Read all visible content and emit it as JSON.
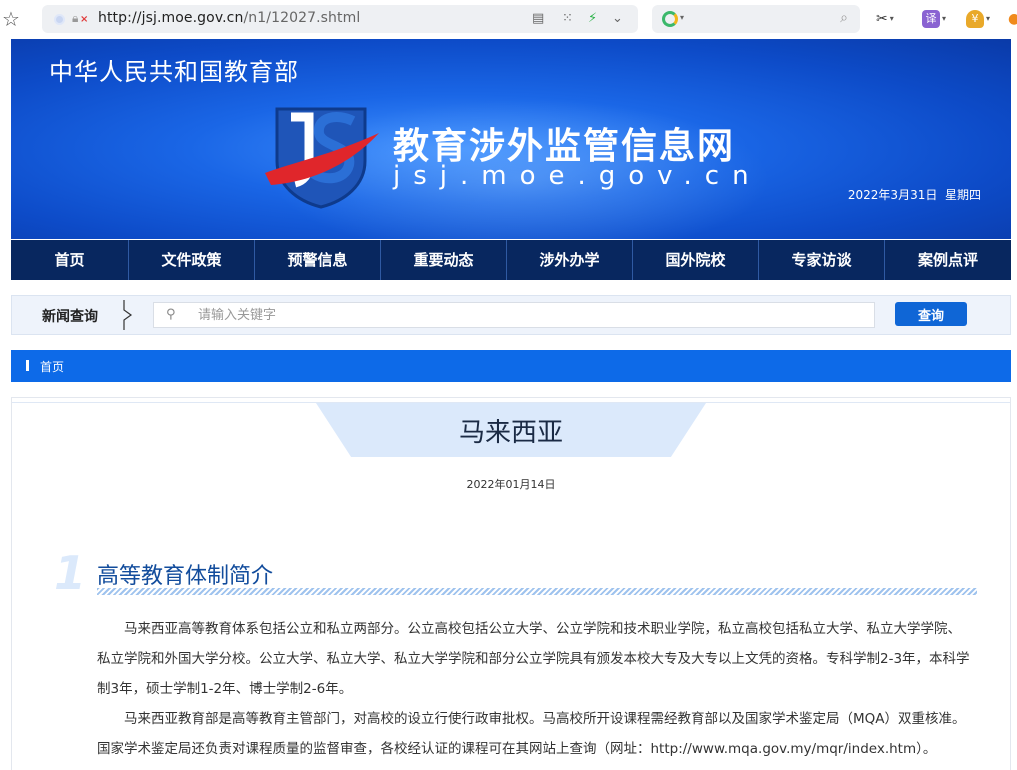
{
  "browser": {
    "url_host": "http://jsj.moe.gov.cn",
    "url_path": "/n1/12027.shtml"
  },
  "toolbar": {
    "translate_label": "译",
    "wallet_label": "¥"
  },
  "banner": {
    "ministry": "中华人民共和国教育部",
    "site_title": "教育涉外监管信息网",
    "site_domain": "jsj.moe.gov.cn",
    "date": "2022年3月31日",
    "weekday": "星期四"
  },
  "nav": {
    "items": [
      {
        "label": "首页"
      },
      {
        "label": "文件政策"
      },
      {
        "label": "预警信息"
      },
      {
        "label": "重要动态"
      },
      {
        "label": "涉外办学"
      },
      {
        "label": "国外院校"
      },
      {
        "label": "专家访谈"
      },
      {
        "label": "案例点评"
      }
    ]
  },
  "search": {
    "label": "新闻查询",
    "placeholder": "请输入关键字",
    "button": "查询"
  },
  "breadcrumb": {
    "home": "首页"
  },
  "article": {
    "title": "马来西亚",
    "date": "2022年01月14日",
    "section_number": "1",
    "section_title": "高等教育体制简介",
    "paragraphs": [
      "马来西亚高等教育体系包括公立和私立两部分。公立高校包括公立大学、公立学院和技术职业学院，私立高校包括私立大学、私立大学学院、私立学院和外国大学分校。公立大学、私立大学、私立大学学院和部分公立学院具有颁发本校大专及大专以上文凭的资格。专科学制2-3年，本科学制3年，硕士学制1-2年、博士学制2-6年。",
      "马来西亚教育部是高等教育主管部门，对高校的设立行使行政审批权。马高校所开设课程需经教育部以及国家学术鉴定局（MQA）双重核准。国家学术鉴定局还负责对课程质量的监督审查，各校经认证的课程可在其网站上查询（网址：http://www.mqa.gov.my/mqr/index.htm）。"
    ]
  },
  "colors": {
    "nav_bg": "#08275f",
    "accent_blue": "#0d6ae8",
    "title_blue": "#124c9c"
  }
}
